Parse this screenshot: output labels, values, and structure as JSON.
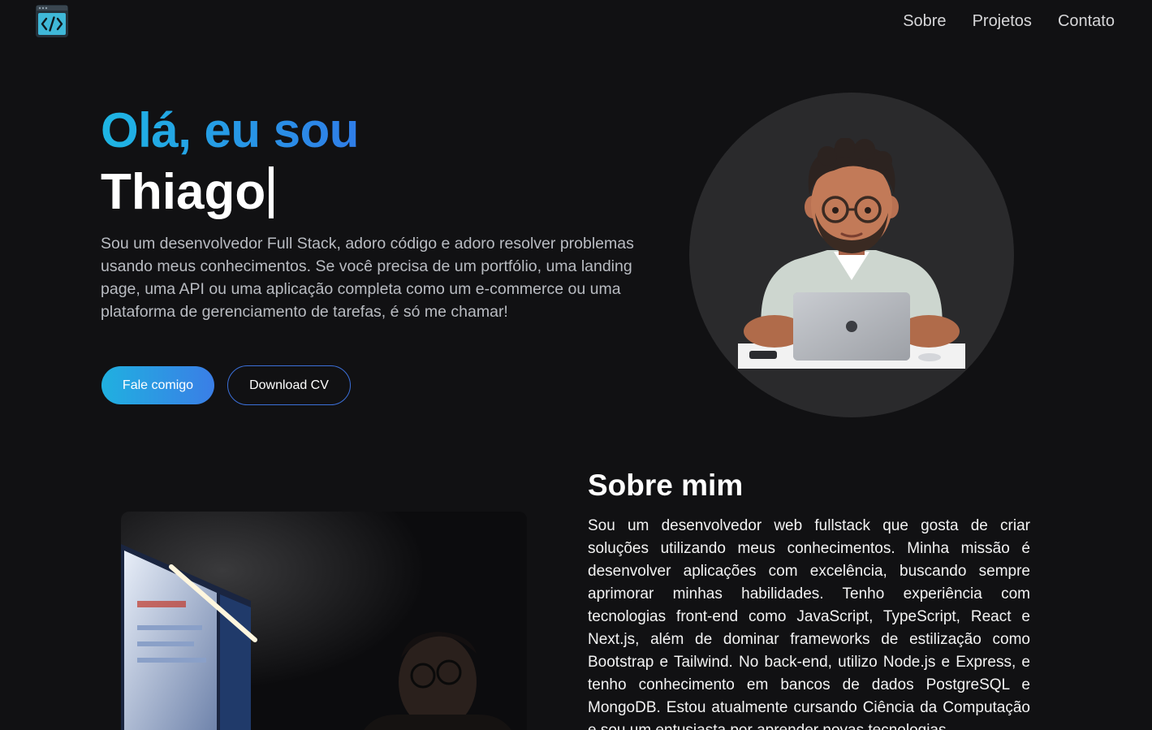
{
  "nav": {
    "logo_icon": "code-brackets-icon",
    "items": [
      {
        "label": "Sobre"
      },
      {
        "label": "Projetos"
      },
      {
        "label": "Contato"
      }
    ]
  },
  "hero": {
    "greeting": "Olá, eu sou",
    "name": "Thiago",
    "description": "Sou um desenvolvedor Full Stack, adoro código e adoro resolver problemas usando meus conhecimentos. Se você precisa de um portfólio, uma landing page, uma API ou uma aplicação completa como um e-commerce ou uma plataforma de gerenciamento de tarefas, é só me chamar!",
    "primary_button": "Fale comigo",
    "secondary_button": "Download CV",
    "accent_gradient": [
      "#1eb6e3",
      "#2f7de8"
    ]
  },
  "about": {
    "title": "Sobre mim",
    "text": "Sou um desenvolvedor web fullstack que gosta de criar soluções utilizando meus conhecimentos. Minha missão é desenvolver aplicações com excelência, buscando sempre aprimorar minhas habilidades. Tenho experiência com tecnologias front-end como JavaScript, TypeScript, React e Next.js, além de dominar frameworks de estilização como Bootstrap e Tailwind. No back-end, utilizo Node.js e Express, e tenho conhecimento em bancos de dados PostgreSQL e MongoDB. Estou atualmente cursando Ciência da Computação e sou um entusiasta por aprender novas tecnologias."
  },
  "colors": {
    "background": "#111113",
    "accent": "#2f7de8",
    "avatar_circle": "#2a2a2c"
  }
}
